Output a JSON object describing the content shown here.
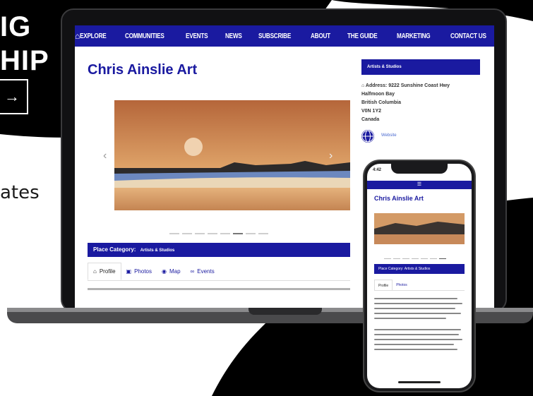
{
  "hero": {
    "title_line1": "IG",
    "title_line2": "HIP",
    "arrow": "→",
    "side_text": "ates"
  },
  "laptop_site": {
    "nav": {
      "home_icon": "home-icon",
      "items": [
        "EXPLORE",
        "COMMUNITIES",
        "EVENTS",
        "NEWS",
        "SUBSCRIBE",
        "ABOUT",
        "THE GUIDE",
        "MARKETING",
        "CONTACT US"
      ]
    },
    "page_title": "Chris Ainslie Art",
    "slider": {
      "prev": "‹",
      "next": "›",
      "dot_count": 8,
      "active_dot": 5
    },
    "place_category": {
      "label": "Place Category:",
      "value": "Artists & Studios"
    },
    "tabs": [
      {
        "icon": "home-icon",
        "label": "Profile"
      },
      {
        "icon": "photo-icon",
        "label": "Photos"
      },
      {
        "icon": "globe-icon",
        "label": "Map"
      },
      {
        "icon": "link-icon",
        "label": "Events"
      }
    ],
    "sidebar": {
      "heading": "Artists & Studios",
      "address_lines": [
        "Address: 9222 Sunshine Coast Hwy",
        "Halfmoon Bay",
        "British Columbia",
        "V0N 1Y2",
        "Canada"
      ],
      "website_label": "Website"
    }
  },
  "phone_site": {
    "status_time": "4:42",
    "menu_icon": "menu-icon",
    "page_title": "Chris Ainslie Art",
    "place_category": "Place Category:",
    "place_category_value": "Artists & Studios",
    "tabs": [
      "Profile",
      "Photos"
    ]
  },
  "colors": {
    "brand_blue": "#1a1aa0",
    "device_frame": "#1a1a1c"
  }
}
